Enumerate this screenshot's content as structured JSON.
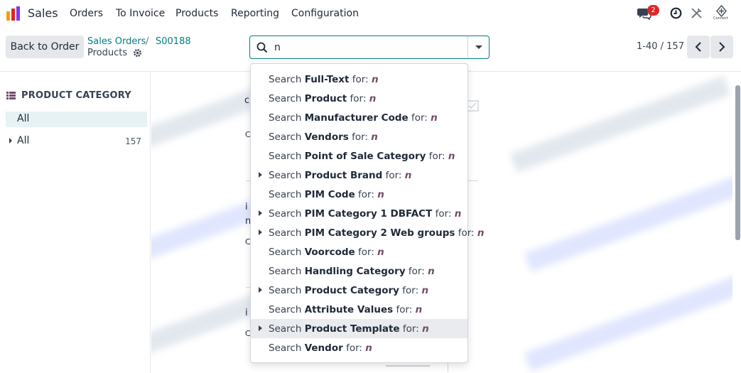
{
  "navbar": {
    "app_name": "Sales",
    "menu": [
      "Orders",
      "To Invoice",
      "Products",
      "Reporting",
      "Configuration"
    ],
    "message_count": "2",
    "connect_label": "Connect"
  },
  "control": {
    "back_label": "Back to Order",
    "breadcrumb": [
      "Sales Orders",
      "S00188"
    ],
    "breadcrumb_sep": "/",
    "current": "Products",
    "search_value": "n",
    "pager": "1-40 / 157"
  },
  "sidebar": {
    "title": "PRODUCT CATEGORY",
    "selected": "All",
    "items": [
      {
        "label": "All",
        "count": "157"
      }
    ]
  },
  "background": {
    "fragments": [
      "c",
      "C",
      "i",
      "n",
      "C",
      "i",
      "C"
    ]
  },
  "dropdown": {
    "prefix": "Search",
    "suffix": "for:",
    "query": "n",
    "items": [
      {
        "field": "Full-Text",
        "expandable": false,
        "active": false
      },
      {
        "field": "Product",
        "expandable": false,
        "active": false
      },
      {
        "field": "Manufacturer Code",
        "expandable": false,
        "active": false
      },
      {
        "field": "Vendors",
        "expandable": false,
        "active": false
      },
      {
        "field": "Point of Sale Category",
        "expandable": false,
        "active": false
      },
      {
        "field": "Product Brand",
        "expandable": true,
        "active": false
      },
      {
        "field": "PIM Code",
        "expandable": false,
        "active": false
      },
      {
        "field": "PIM Category 1 DBFACT",
        "expandable": true,
        "active": false
      },
      {
        "field": "PIM Category 2 Web groups",
        "expandable": true,
        "active": false
      },
      {
        "field": "Voorcode",
        "expandable": false,
        "active": false
      },
      {
        "field": "Handling Category",
        "expandable": false,
        "active": false
      },
      {
        "field": "Product Category",
        "expandable": true,
        "active": false
      },
      {
        "field": "Attribute Values",
        "expandable": false,
        "active": false
      },
      {
        "field": "Product Template",
        "expandable": true,
        "active": true
      },
      {
        "field": "Vendor",
        "expandable": false,
        "active": false
      }
    ]
  },
  "colors": {
    "accent": "#017e84",
    "query": "#714b67",
    "badge": "#dc2626"
  }
}
